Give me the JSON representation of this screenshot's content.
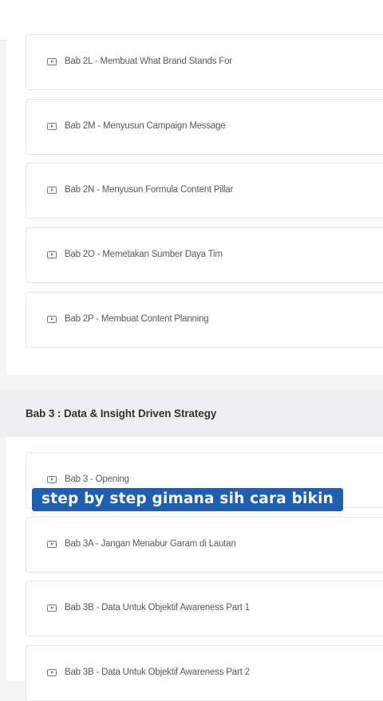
{
  "lessons_bab2": [
    {
      "label": "Bab 2L - Membuat What Brand Stands For"
    },
    {
      "label": "Bab 2M - Menyusun Campaign Message"
    },
    {
      "label": "Bab 2N - Menyusun Formula Content Pillar"
    },
    {
      "label": "Bab 2O - Memetakan Sumber Daya Tim"
    },
    {
      "label": "Bab 2P - Membuat Content Planning"
    }
  ],
  "section_bab3": {
    "title": "Bab 3 : Data & Insight Driven Strategy",
    "lessons": [
      {
        "label": "Bab 3 - Opening"
      },
      {
        "label": "Bab 3A - Jangan Menabur Garam di Lautan"
      },
      {
        "label": "Bab 3B - Data Untuk Objektif Awareness Part 1"
      },
      {
        "label": "Bab 3B - Data Untuk Objektif Awareness Part 2"
      }
    ]
  },
  "caption": "step by step gimana sih cara bikin",
  "colors": {
    "caption_bg": "#1e5fb4",
    "page_bg": "#f4f4f5",
    "card_border": "#e7e7ea"
  },
  "icons": [
    "play-video-icon"
  ]
}
